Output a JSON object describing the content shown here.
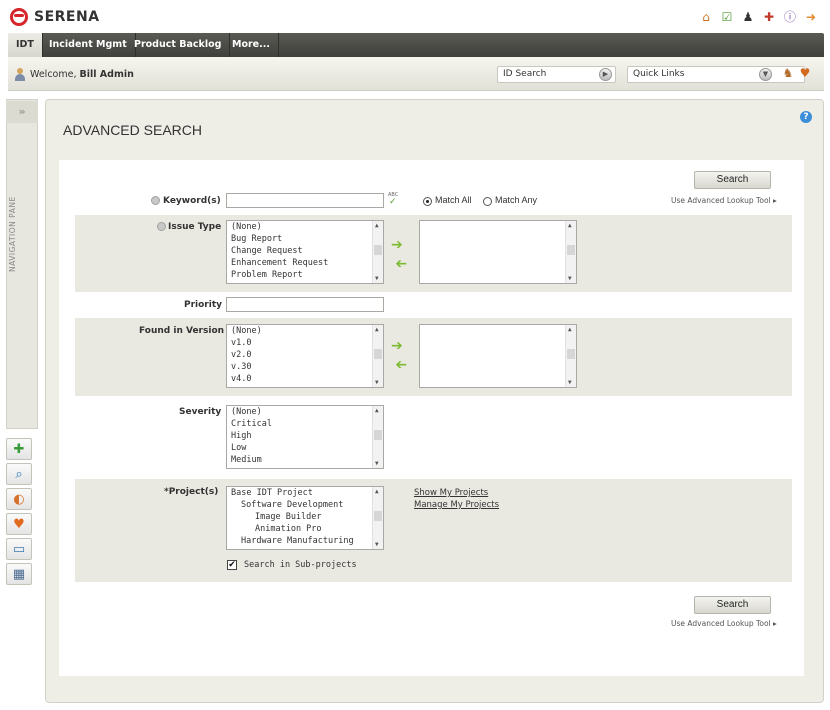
{
  "app": {
    "brand": "SERENA",
    "brand_color": "#d6262b"
  },
  "header": {
    "icons": [
      "home-icon",
      "tasks-icon",
      "user-icon",
      "admin-icon",
      "info-icon",
      "logout-icon"
    ]
  },
  "tabs": [
    {
      "label": "IDT",
      "active": true
    },
    {
      "label": "Incident Mgmt",
      "active": false
    },
    {
      "label": "Product Backlog",
      "active": false
    },
    {
      "label": "More...",
      "active": false
    }
  ],
  "welcome": {
    "prefix": "Welcome,",
    "user": "Bill Admin"
  },
  "id_search": {
    "value": "ID Search"
  },
  "quick_links": {
    "value": "Quick Links"
  },
  "nav_pane": {
    "label": "NAVIGATION PANE",
    "toggle": "»"
  },
  "page": {
    "title": "ADVANCED SEARCH",
    "help": "?"
  },
  "form": {
    "search_label": "Search",
    "advanced_lookup": "Use Advanced Lookup Tool ▸",
    "keyword": {
      "label": "Keyword(s)",
      "value": "",
      "spell": "ABC"
    },
    "match_all": "Match All",
    "match_any": "Match Any",
    "issue_type": {
      "label": "Issue Type",
      "options": [
        "(None)",
        "Bug Report",
        "Change Request",
        "Enhancement Request",
        "Problem Report"
      ]
    },
    "priority": {
      "label": "Priority",
      "value": ""
    },
    "found_in_version": {
      "label": "Found in Version",
      "options": [
        "(None)",
        "v1.0",
        "v2.0",
        "v.30",
        "v4.0"
      ]
    },
    "severity": {
      "label": "Severity",
      "options": [
        "(None)",
        "Critical",
        "High",
        "Low",
        "Medium"
      ]
    },
    "projects": {
      "label": "*Project(s)",
      "options": [
        "Base IDT Project",
        "Software Development",
        "Image Builder",
        "Animation Pro",
        "Hardware Manufacturing"
      ],
      "show_my": "Show My Projects",
      "manage_my": "Manage My Projects"
    },
    "sub_projects": "Search in Sub-projects"
  }
}
